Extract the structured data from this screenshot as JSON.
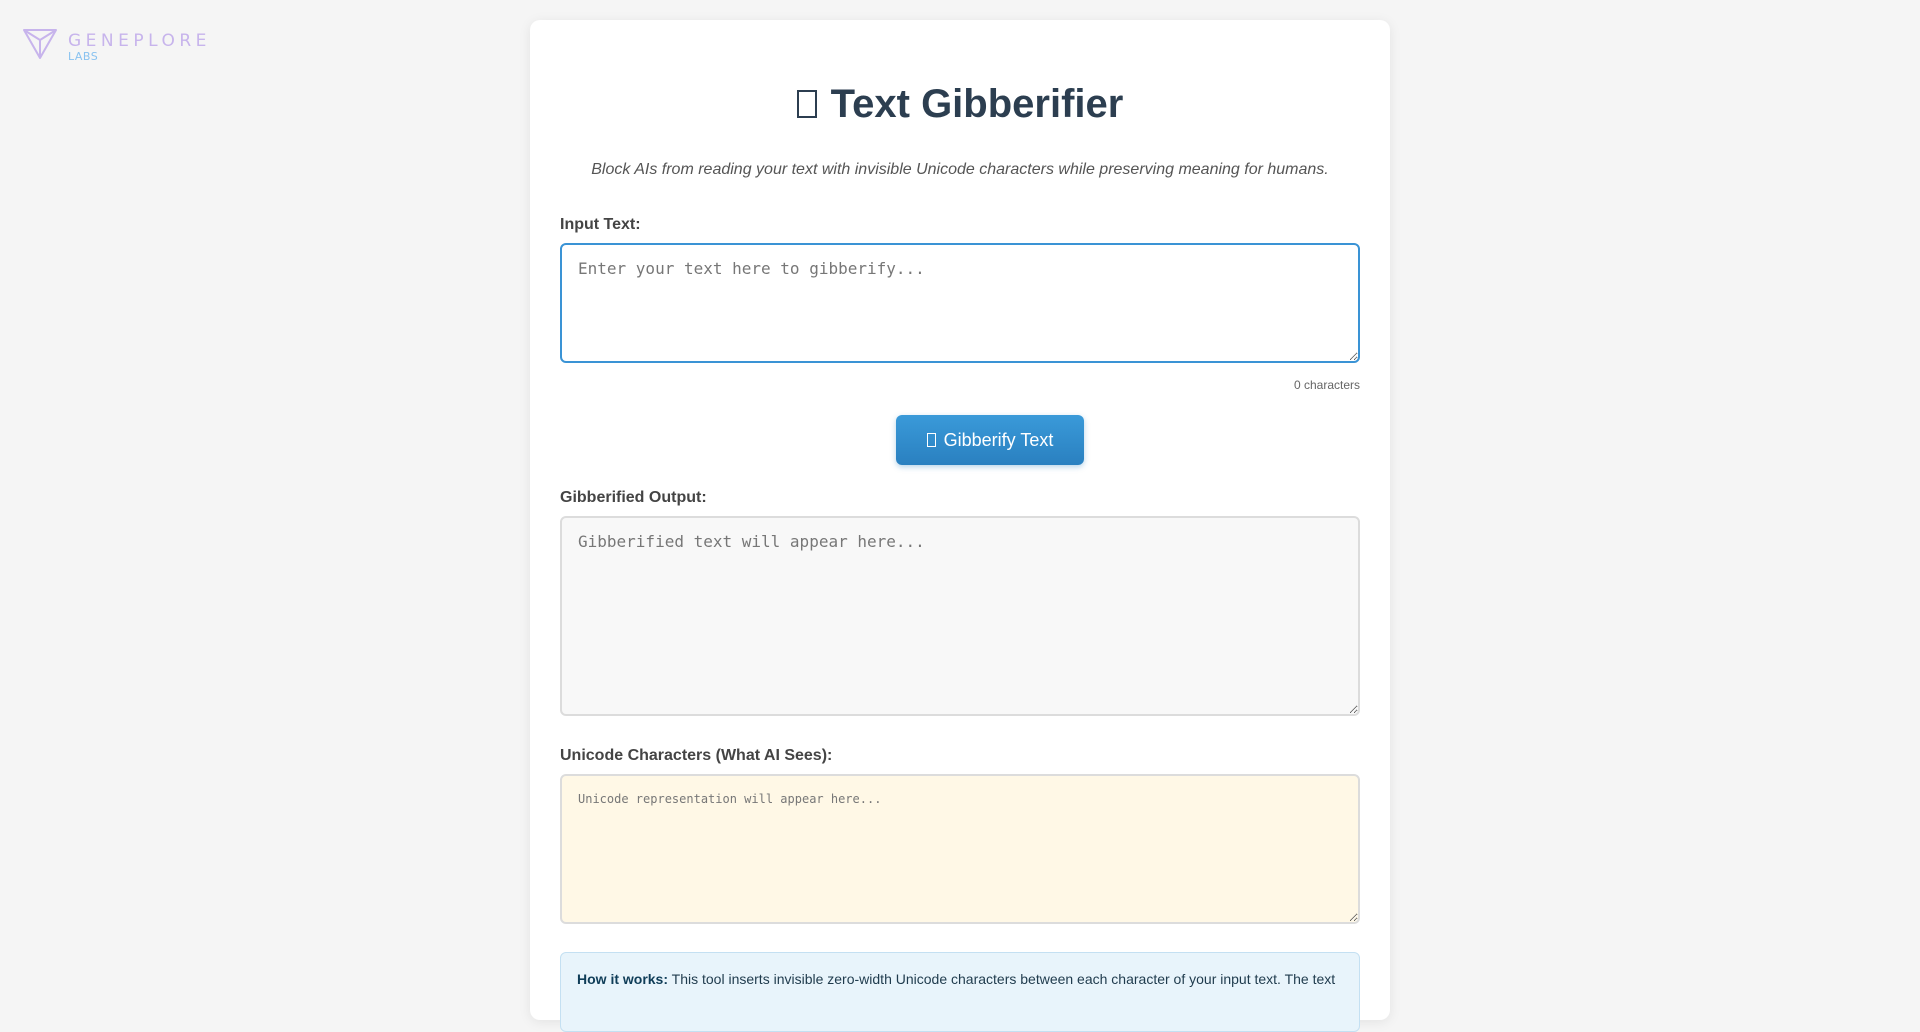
{
  "brand": {
    "name": "GENEPLORE",
    "sub": "LABS",
    "icon": "triangle-logo-icon",
    "color_main": "#c7b4ec",
    "color_sub": "#89c2f0"
  },
  "header": {
    "title_icon": "missing-glyph-icon",
    "title": "Text Gibberifier",
    "subtitle": "Block AIs from reading your text with invisible Unicode characters while preserving meaning for humans."
  },
  "input": {
    "label": "Input Text:",
    "value": "",
    "placeholder": "Enter your text here to gibberify...",
    "counter": "0 characters"
  },
  "action": {
    "icon": "missing-glyph-icon",
    "label": "Gibberify Text",
    "color": "#2a80c0"
  },
  "output": {
    "label": "Gibberified Output:",
    "value": "",
    "placeholder": "Gibberified text will appear here..."
  },
  "unicode": {
    "label": "Unicode Characters (What AI Sees):",
    "value": "",
    "placeholder": "Unicode representation will appear here...",
    "bg_color": "#fff8e6"
  },
  "info": {
    "heading": "How it works:",
    "text": "This tool inserts invisible zero-width Unicode characters between each character of your input text. The text"
  }
}
